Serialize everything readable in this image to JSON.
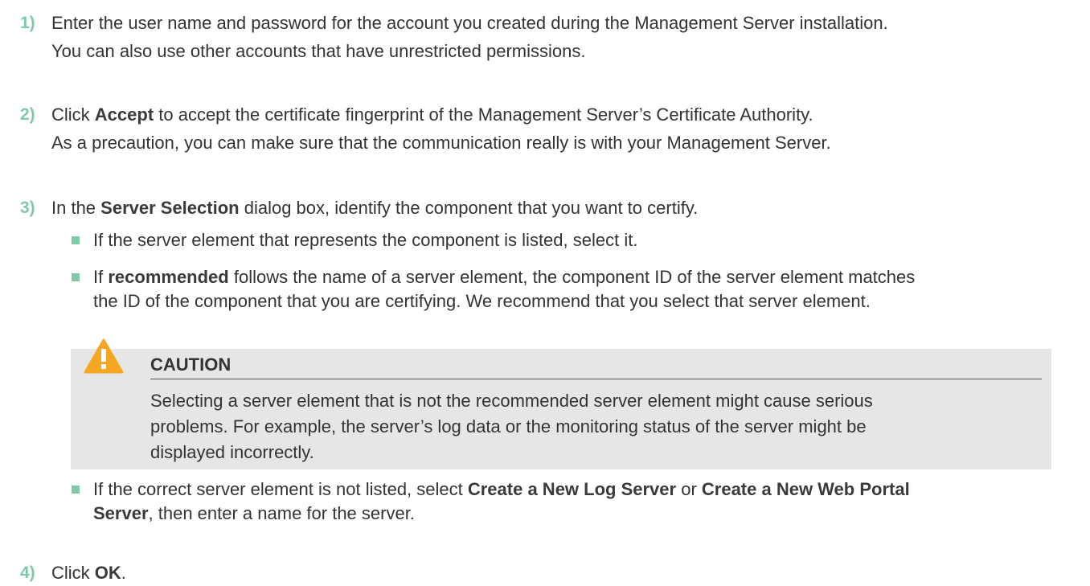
{
  "steps": [
    {
      "number": "1)",
      "lines": [
        "Enter the user name and password for the account you created during the Management Server installation.",
        "You can also use other accounts that have unrestricted permissions."
      ]
    },
    {
      "number": "2)",
      "line1": {
        "pre": "Click ",
        "bold": "Accept",
        "post": " to accept the certificate fingerprint of the Management Server’s Certificate Authority."
      },
      "line2": "As a precaution, you can make sure that the communication really is with your Management Server."
    },
    {
      "number": "3)",
      "line1": {
        "pre": "In the ",
        "bold": "Server Selection",
        "post": " dialog box, identify the component that you want to certify."
      },
      "bullets": [
        {
          "line1": "If the server element that represents the component is listed, select it."
        },
        {
          "line1": {
            "pre": "If ",
            "bold": "recommended",
            "post": " follows the name of a server element, the component ID of the server element matches"
          },
          "line2": "the ID of the component that you are certifying. We recommend that you select that server element."
        },
        {
          "line1": {
            "pre": "If the correct server element is not listed, select ",
            "bold1": "Create a New Log Server",
            "mid": " or ",
            "bold2": "Create a New Web Portal"
          },
          "line2": {
            "bold": "Server",
            "post": ", then enter a name for the server."
          }
        }
      ],
      "caution": {
        "title": "CAUTION",
        "icon": "warning-triangle-icon",
        "lines": [
          "Selecting a server element that is not the recommended server element might cause serious",
          "problems. For example, the server’s log data or the monitoring status of the server might be",
          "displayed incorrectly."
        ]
      }
    },
    {
      "number": "4)",
      "line1": {
        "pre": "Click ",
        "bold": "OK",
        "post": "."
      }
    }
  ],
  "colors": {
    "accent": "#7fc9a7",
    "caution_bg": "#e6e6e6",
    "warning_icon": "#f5a623",
    "text": "#333333"
  }
}
